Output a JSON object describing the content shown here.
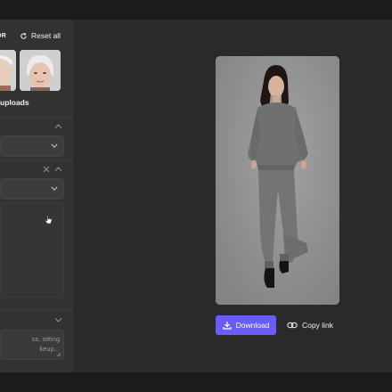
{
  "sidebar": {
    "header_title_tail": "OR",
    "reset_label": "Reset all",
    "uploads_label": "uploads",
    "prompt_placeholder": "ss, sitting\nkeup..."
  },
  "actions": {
    "download_label": "Download",
    "copy_link_label": "Copy link"
  },
  "colors": {
    "accent": "#6a5cf6",
    "panel": "#323232",
    "canvas": "#2a2a2a"
  }
}
